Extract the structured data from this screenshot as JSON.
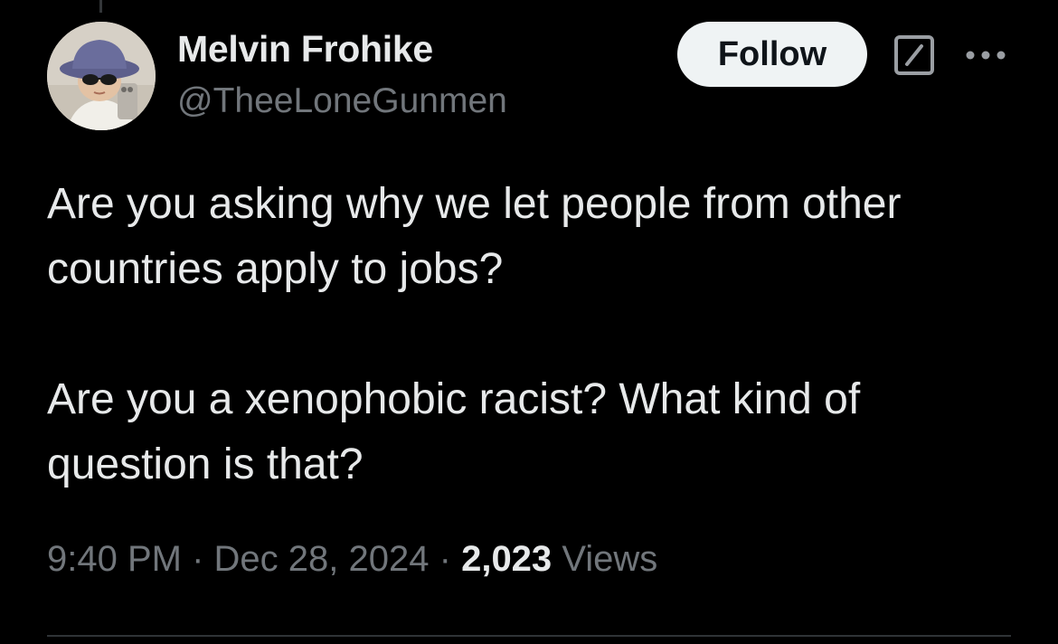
{
  "author": {
    "display_name": "Melvin Frohike",
    "handle": "@TheeLoneGunmen"
  },
  "actions": {
    "follow_label": "Follow",
    "grok_icon": "grok-icon",
    "more_icon": "more-options-icon"
  },
  "tweet": {
    "paragraphs": [
      "Are you asking why we let people from other countries apply to jobs?",
      "Are you a xenophobic racist? What kind of question is that?"
    ]
  },
  "meta": {
    "time": "9:40 PM",
    "separator": "·",
    "date": "Dec 28, 2024",
    "views_count": "2,023",
    "views_label": "Views"
  },
  "colors": {
    "background": "#000000",
    "primary_text": "#e7e9ea",
    "secondary_text": "#71767b",
    "follow_bg": "#eff3f4"
  }
}
